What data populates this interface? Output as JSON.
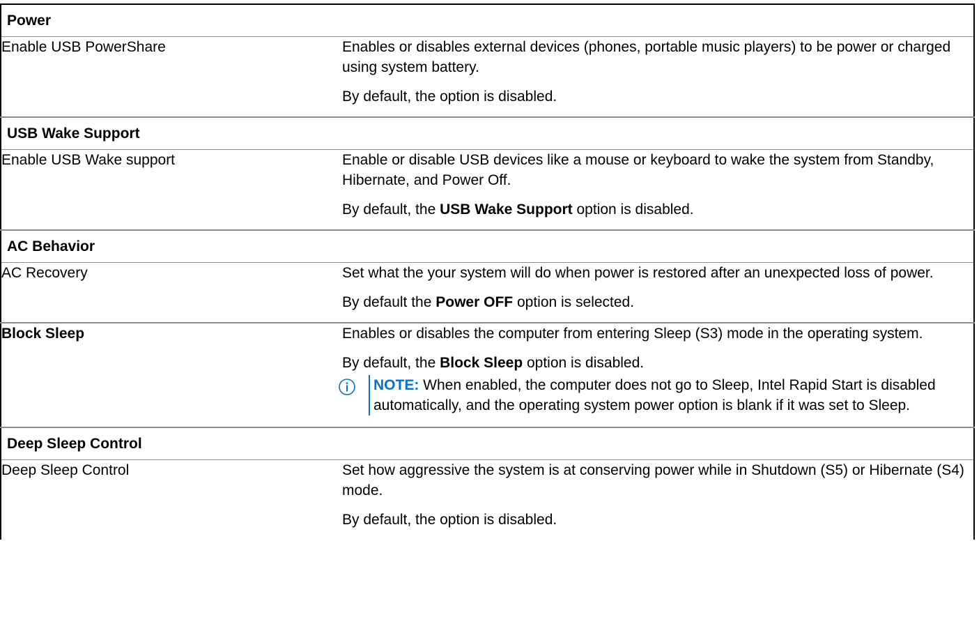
{
  "sections": {
    "power": {
      "title": "Power",
      "name": "Enable USB PowerShare",
      "desc1": "Enables or disables external devices (phones, portable music players) to be power or charged using system battery.",
      "desc2": "By default, the option is disabled."
    },
    "usb_wake": {
      "title": "USB Wake Support",
      "name": "Enable USB Wake support",
      "desc1": "Enable or disable USB devices like a mouse or keyboard to wake the system from Standby, Hibernate, and Power Off.",
      "desc2_pre": "By default, the ",
      "desc2_bold": "USB Wake Support",
      "desc2_post": " option is disabled."
    },
    "ac": {
      "title": "AC Behavior",
      "name": "AC Recovery",
      "desc1": "Set what the your system will do when power is restored after an unexpected loss of power.",
      "desc2_pre": "By default the ",
      "desc2_bold": "Power OFF",
      "desc2_post": " option is selected."
    },
    "block_sleep": {
      "name": "Block Sleep",
      "desc1": "Enables or disables the computer from entering Sleep (S3) mode in the operating system.",
      "desc2_pre": "By default, the ",
      "desc2_bold": "Block Sleep",
      "desc2_post": " option is disabled.",
      "note_label": "NOTE:",
      "note_text": " When enabled, the computer does not go to Sleep, Intel Rapid Start is disabled automatically, and the operating system power option is blank if it was set to Sleep."
    },
    "deep_sleep": {
      "title": "Deep Sleep Control",
      "name": "Deep Sleep Control",
      "desc1": "Set how aggressive the system is at conserving power while in Shutdown (S5) or Hibernate (S4) mode.",
      "desc2": "By default, the option is disabled."
    }
  },
  "colors": {
    "note_accent": "#0672cb",
    "row_border": "#8c8c8c"
  },
  "icons": {
    "note": "info-circle-icon"
  }
}
